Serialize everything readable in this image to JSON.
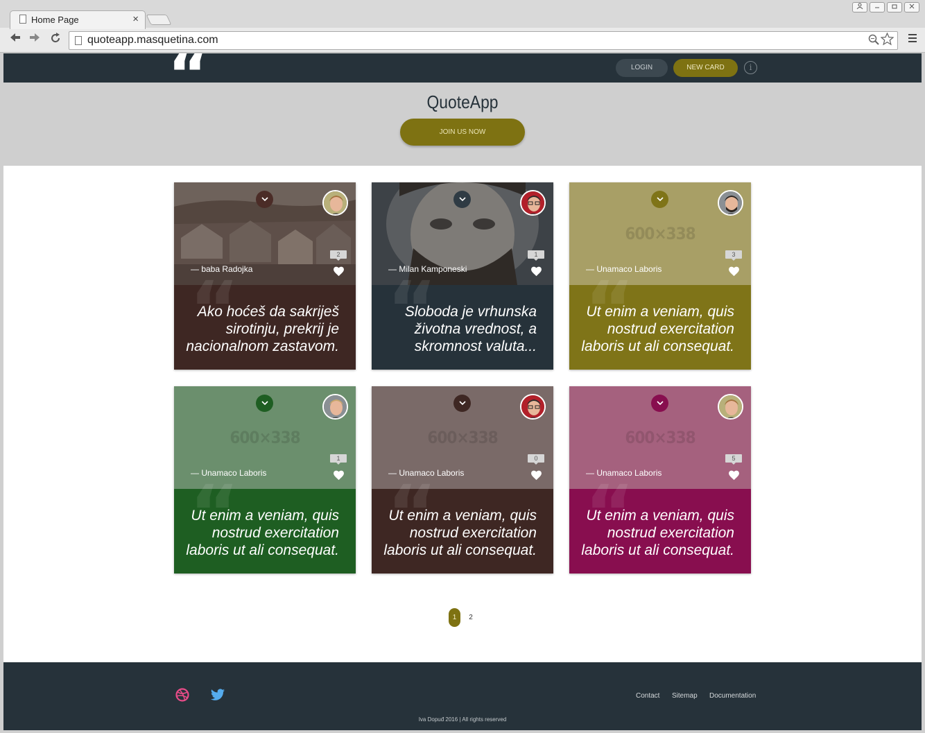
{
  "browser": {
    "tab_title": "Home Page",
    "tab_close": "×",
    "url": "quoteapp.masquetina.com",
    "window_buttons": [
      "user-icon",
      "minimize-icon",
      "restore-icon",
      "close-icon"
    ]
  },
  "nav": {
    "login_label": "LOGIN",
    "new_card_label": "NEW CARD",
    "info_label": "i"
  },
  "hero": {
    "title": "QuoteApp",
    "join_label": "JOIN US NOW"
  },
  "cards": [
    {
      "author": "— baba Radojka",
      "likes": "2",
      "quote": "Ako hoćeš da sakriješ sirotinju, prekrij je nacionalnom zastavom.",
      "placeholder": "",
      "image": "village-photo",
      "body_color": "#3e2723",
      "image_color": "#5a4a44",
      "chev_color": "#4b2c27",
      "avatar": "woman-avatar"
    },
    {
      "author": "— Milan Kamponeski",
      "likes": "1",
      "quote": "Sloboda je vrhunska životna vrednost, a skromnost valuta...",
      "placeholder": "",
      "image": "bearded-man-photo",
      "body_color": "#26323a",
      "image_color": "#4d5257",
      "chev_color": "#2f3b44",
      "avatar": "man-glasses-avatar"
    },
    {
      "author": "— Unamaco Laboris",
      "likes": "3",
      "quote": "Ut enim a veniam, quis nostrud exercitation laboris ut ali consequat.",
      "placeholder": "600×338",
      "image": "placeholder",
      "body_color": "#7f7418",
      "image_color": "#a89f66",
      "chev_color": "#7f7418",
      "avatar": "man-beard-avatar"
    },
    {
      "author": "— Unamaco Laboris",
      "likes": "1",
      "quote": "Ut enim a veniam, quis nostrud exercitation laboris ut ali consequat.",
      "placeholder": "600×338",
      "image": "placeholder",
      "body_color": "#1e5e22",
      "image_color": "#6b8f6d",
      "chev_color": "#1e5e22",
      "avatar": "blond-man-avatar"
    },
    {
      "author": "— Unamaco Laboris",
      "likes": "0",
      "quote": "Ut enim a veniam, quis nostrud exercitation laboris ut ali consequat.",
      "placeholder": "600×338",
      "image": "placeholder",
      "body_color": "#3e2723",
      "image_color": "#7a6a68",
      "chev_color": "#3e2723",
      "avatar": "man-glasses-avatar"
    },
    {
      "author": "— Unamaco Laboris",
      "likes": "5",
      "quote": "Ut enim a veniam, quis nostrud exercitation laboris ut ali consequat.",
      "placeholder": "600×338",
      "image": "placeholder",
      "body_color": "#880e4f",
      "image_color": "#a5617e",
      "chev_color": "#880e4f",
      "avatar": "woman-avatar"
    }
  ],
  "pagination": {
    "pages": [
      "1",
      "2"
    ],
    "current": "1"
  },
  "footer": {
    "links": [
      "Contact",
      "Sitemap",
      "Documentation"
    ],
    "copyright": "Iva Dopuđ 2016 | All rights reserved",
    "social": [
      "dribbble-icon",
      "twitter-icon"
    ]
  },
  "colors": {
    "navbar": "#26323a",
    "accent": "#7e7212",
    "hero_bg": "#cfcfcf"
  }
}
